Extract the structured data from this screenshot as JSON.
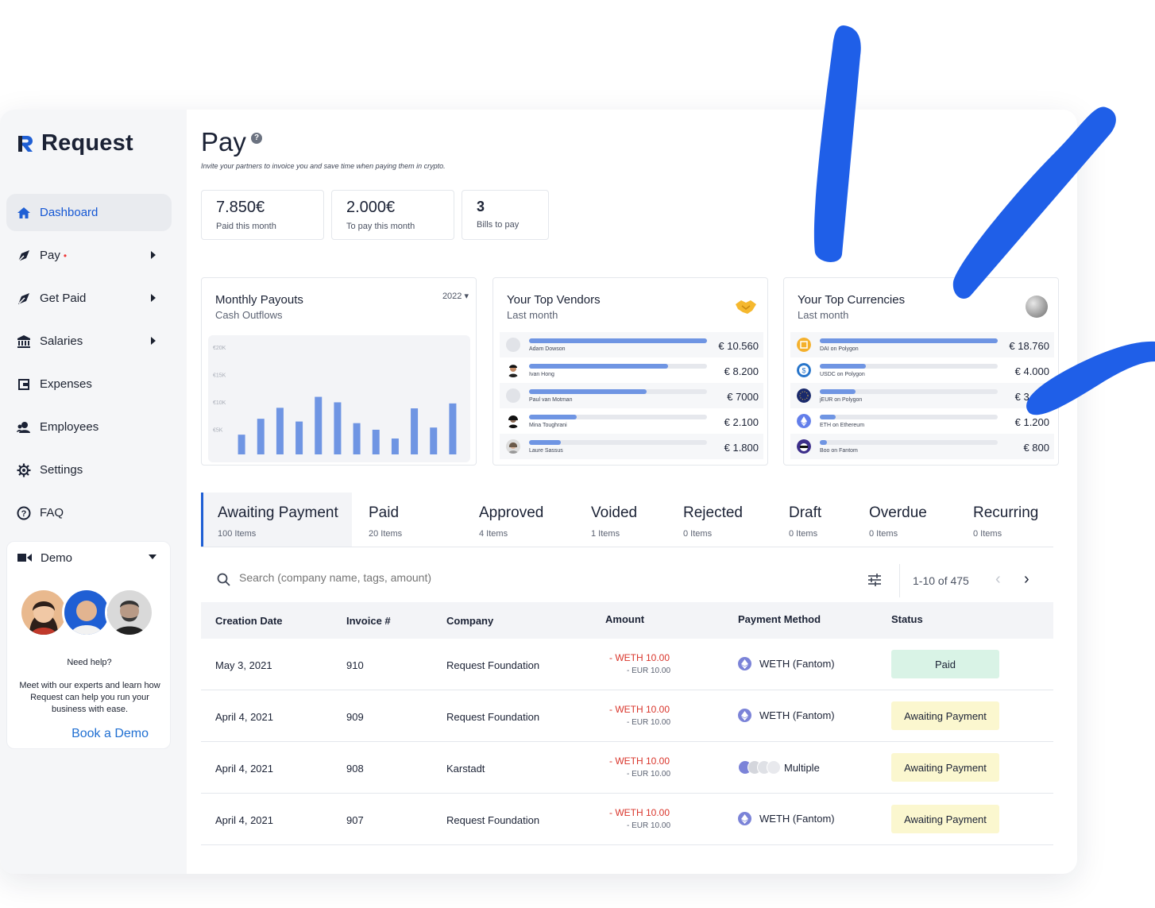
{
  "brand": {
    "name": "Request",
    "accent": "#1f5fd4"
  },
  "sidebar": {
    "items": [
      {
        "label": "Dashboard",
        "icon": "home-icon"
      },
      {
        "label": "Pay",
        "icon": "send-icon",
        "dot": "•"
      },
      {
        "label": "Get Paid",
        "icon": "receive-icon"
      },
      {
        "label": "Salaries",
        "icon": "bank-icon"
      },
      {
        "label": "Expenses",
        "icon": "receipt-icon"
      },
      {
        "label": "Employees",
        "icon": "people-icon"
      },
      {
        "label": "Settings",
        "icon": "gear-icon"
      },
      {
        "label": "FAQ",
        "icon": "question-icon"
      }
    ],
    "demo": {
      "label": "Demo",
      "need_help": "Need help?",
      "description": "Meet with our experts and learn how Request can help you run your business with ease.",
      "cta": "Book a Demo"
    }
  },
  "page": {
    "title": "Pay",
    "subtitle": "Invite your partners to invoice you and save time when paying them in crypto."
  },
  "stats": [
    {
      "value": "7.850€",
      "label": "Paid this month"
    },
    {
      "value": "2.000€",
      "label": "To pay this month"
    },
    {
      "value": "3",
      "label": "Bills to pay"
    }
  ],
  "payouts": {
    "title": "Monthly Payouts",
    "subtitle": "Cash Outflows",
    "year": "2022 ▾"
  },
  "chart_data": {
    "type": "bar",
    "title": "Monthly Payouts",
    "subtitle": "Cash Outflows",
    "ylabels": [
      "€20K",
      "€15K",
      "€10K",
      "€5K"
    ],
    "ylim": [
      0,
      20000
    ],
    "values": [
      3600,
      6500,
      8500,
      6000,
      10500,
      9500,
      5700,
      4500,
      2900,
      8400,
      4900,
      9300
    ],
    "bar_color": "#6f95e3",
    "grid": false
  },
  "vendors": {
    "title": "Your Top Vendors",
    "subtitle": "Last month",
    "rows": [
      {
        "name": "Adam Dowson",
        "value": "€ 10.560",
        "ratio": 1.0
      },
      {
        "name": "Ivan Hong",
        "value": "€ 8.200",
        "ratio": 0.78
      },
      {
        "name": "Paul van Motman",
        "value": "€ 7000",
        "ratio": 0.66
      },
      {
        "name": "Mina Toughrani",
        "value": "€ 2.100",
        "ratio": 0.27
      },
      {
        "name": "Laure Sassus",
        "value": "€ 1.800",
        "ratio": 0.18
      }
    ]
  },
  "currencies": {
    "title": "Your Top Currencies",
    "subtitle": "Last month",
    "rows": [
      {
        "name": "DAI on Polygon",
        "value": "€ 18.760",
        "ratio": 1.0,
        "color": "#f4b02c"
      },
      {
        "name": "USDC on Polygon",
        "value": "€ 4.000",
        "ratio": 0.26,
        "color": "#2775ca"
      },
      {
        "name": "jEUR on Polygon",
        "value": "€ 3.500",
        "ratio": 0.2,
        "color": "#1a2a6c"
      },
      {
        "name": "ETH on Ethereum",
        "value": "€ 1.200",
        "ratio": 0.09,
        "color": "#627eea"
      },
      {
        "name": "Boo on Fantom",
        "value": "€ 800",
        "ratio": 0.03,
        "color": "#3c2e8a"
      }
    ]
  },
  "tabs": [
    {
      "label": "Awaiting Payment",
      "count": "100 Items"
    },
    {
      "label": "Paid",
      "count": "20 Items"
    },
    {
      "label": "Approved",
      "count": "4 Items"
    },
    {
      "label": "Voided",
      "count": "1 Items"
    },
    {
      "label": "Rejected",
      "count": "0 Items"
    },
    {
      "label": "Draft",
      "count": "0 Items"
    },
    {
      "label": "Overdue",
      "count": "0 Items"
    },
    {
      "label": "Recurring",
      "count": "0 Items"
    }
  ],
  "search": {
    "placeholder": "Search (company name, tags, amount)",
    "pagination": "1-10 of 475"
  },
  "table": {
    "headers": [
      "Creation Date",
      "Invoice #",
      "Company",
      "Amount",
      "Payment Method",
      "Status"
    ],
    "rows": [
      {
        "date": "May 3, 2021",
        "invoice": "910",
        "company": "Request Foundation",
        "amount": "- WETH 10.00",
        "amount_eur": "- EUR 10.00",
        "method": "WETH (Fantom)",
        "status": "Paid"
      },
      {
        "date": "April 4, 2021",
        "invoice": "909",
        "company": "Request Foundation",
        "amount": "- WETH 10.00",
        "amount_eur": "- EUR 10.00",
        "method": "WETH (Fantom)",
        "status": "Awaiting Payment"
      },
      {
        "date": "April 4, 2021",
        "invoice": "908",
        "company": "Karstadt",
        "amount": "- WETH 10.00",
        "amount_eur": "- EUR 10.00",
        "method": "Multiple",
        "status": "Awaiting Payment"
      },
      {
        "date": "April 4, 2021",
        "invoice": "907",
        "company": "Request Foundation",
        "amount": "- WETH 10.00",
        "amount_eur": "- EUR 10.00",
        "method": "WETH (Fantom)",
        "status": "Awaiting Payment"
      }
    ]
  }
}
